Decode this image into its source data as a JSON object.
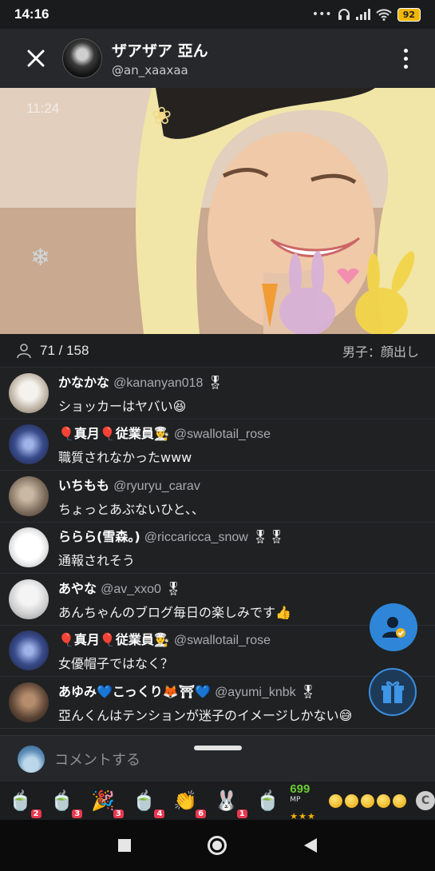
{
  "status_bar": {
    "time": "14:16",
    "dots": "•••",
    "battery": "92"
  },
  "header": {
    "name": "ザアザア 亞ん",
    "handle": "@an_xaaxaa"
  },
  "video": {
    "timestamp": "11:24"
  },
  "viewers": {
    "count": "71 / 158",
    "note": "男子：顔出し"
  },
  "comments": [
    {
      "name": "かなかな",
      "handle": "@kananyan018",
      "badge": "🎖",
      "text": "ショッカーはヤバい😆",
      "avatar_color": "#cfc6b9"
    },
    {
      "name": "🎈真月🎈従業員👨‍🍳",
      "handle": "@swallotail_rose",
      "badge": "",
      "text": "職質されなかったwww",
      "avatar_color": "#3b4d8a"
    },
    {
      "name": "いちもも",
      "handle": "@ryuryu_carav",
      "badge": "",
      "text": "ちょっとあぶないひと、、",
      "avatar_color": "#7b6a5a"
    },
    {
      "name": "ららら(雪森。)",
      "handle": "@riccaricca_snow",
      "badge": "🎖🎖",
      "text": "通報されそう",
      "avatar_color": "#e9e9e9"
    },
    {
      "name": "あやな",
      "handle": "@av_xxo0",
      "badge": "🎖",
      "text": "あんちゃんのブログ毎日の楽しみです👍",
      "avatar_color": "#d9d9d9"
    },
    {
      "name": "🎈真月🎈従業員👨‍🍳",
      "handle": "@swallotail_rose",
      "badge": "",
      "text": "女優帽子ではなく？",
      "avatar_color": "#3b4d8a"
    },
    {
      "name": "あゆみ💙こっくり🦊⛩💙",
      "handle": "@ayumi_knbk",
      "badge": "🎖",
      "text": "亞んくんはテンションが迷子のイメージしかない😅",
      "avatar_color": "#4a3a30"
    }
  ],
  "input": {
    "placeholder": "コメントする"
  },
  "gifts": [
    {
      "icon": "🍵",
      "count": "2"
    },
    {
      "icon": "🍵",
      "count": "3"
    },
    {
      "icon": "🎉",
      "count": "3"
    },
    {
      "icon": "🍵",
      "count": "4"
    },
    {
      "icon": "👏",
      "count": "6"
    },
    {
      "icon": "🐰",
      "count": "1"
    },
    {
      "icon": "🍵",
      "count": ""
    }
  ],
  "mp": {
    "value": "699",
    "unit": "MP",
    "stars": "★★★"
  },
  "c_button": "C"
}
